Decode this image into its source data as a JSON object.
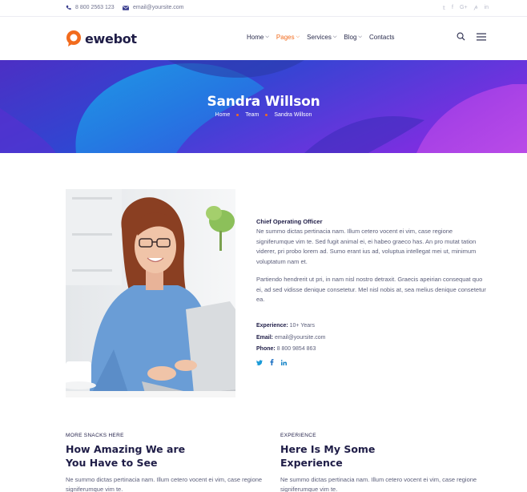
{
  "topbar": {
    "phone": "8 800 2563 123",
    "email": "email@yoursite.com",
    "social_icons": [
      "twitter-icon",
      "facebook-icon",
      "google-plus-icon",
      "pinterest-icon",
      "linkedin-icon"
    ],
    "social_glyphs": [
      "𝕥",
      "f",
      "G+",
      "𝓅",
      "in"
    ]
  },
  "header": {
    "logo_text": "ewebot",
    "nav": [
      {
        "label": "Home",
        "has_dropdown": true
      },
      {
        "label": "Pages",
        "has_dropdown": true,
        "active": true
      },
      {
        "label": "Services",
        "has_dropdown": true
      },
      {
        "label": "Blog",
        "has_dropdown": true
      },
      {
        "label": "Contacts",
        "has_dropdown": false
      }
    ]
  },
  "hero": {
    "title": "Sandra Willson",
    "breadcrumbs": [
      "Home",
      "Team",
      "Sandra Willson"
    ]
  },
  "profile": {
    "role": "Chief Operating Officer",
    "bio_1": "Ne summo dictas pertinacia nam. Illum cetero vocent ei vim, case regione signiferumque vim te. Sed fugit animal ei, ei habeo graeco has. An pro mutat tation viderer, pri probo lorem ad. Sumo erant ius ad, voluptua intellegat mei ut, minimum voluptatum nam et.",
    "bio_2": "Partiendo hendrerit ut pri, in nam nisl nostro detraxit. Graecis apeirian consequat quo ei, ad sed vidisse denique consetetur. Mel nisl nobis at, sea melius denique consetetur ea.",
    "experience_label": "Experience:",
    "experience_value": "10+ Years",
    "email_label": "Email:",
    "email_value": "email@yoursite.com",
    "phone_label": "Phone:",
    "phone_value": "8 800 9854 863"
  },
  "sections": [
    {
      "eyebrow": "MORE SNACKS HERE",
      "title_line1": "How Amazing We are",
      "title_line2": "You Have to See",
      "text": "Ne summo dictas pertinacia nam. Illum cetero vocent ei vim, case regione signiferumque vim te."
    },
    {
      "eyebrow": "EXPERIENCE",
      "title_line1": "Here Is My Some",
      "title_line2": "Experience",
      "text": "Ne summo dictas pertinacia nam. Illum cetero vocent ei vim, case regione signiferumque vim te."
    }
  ],
  "colors": {
    "accent": "#f26b1d",
    "navy": "#1f1d47",
    "hero_purple": "#5a2bd6",
    "hero_blue": "#1e8fe0",
    "social_blue": "#1b9bd8"
  }
}
